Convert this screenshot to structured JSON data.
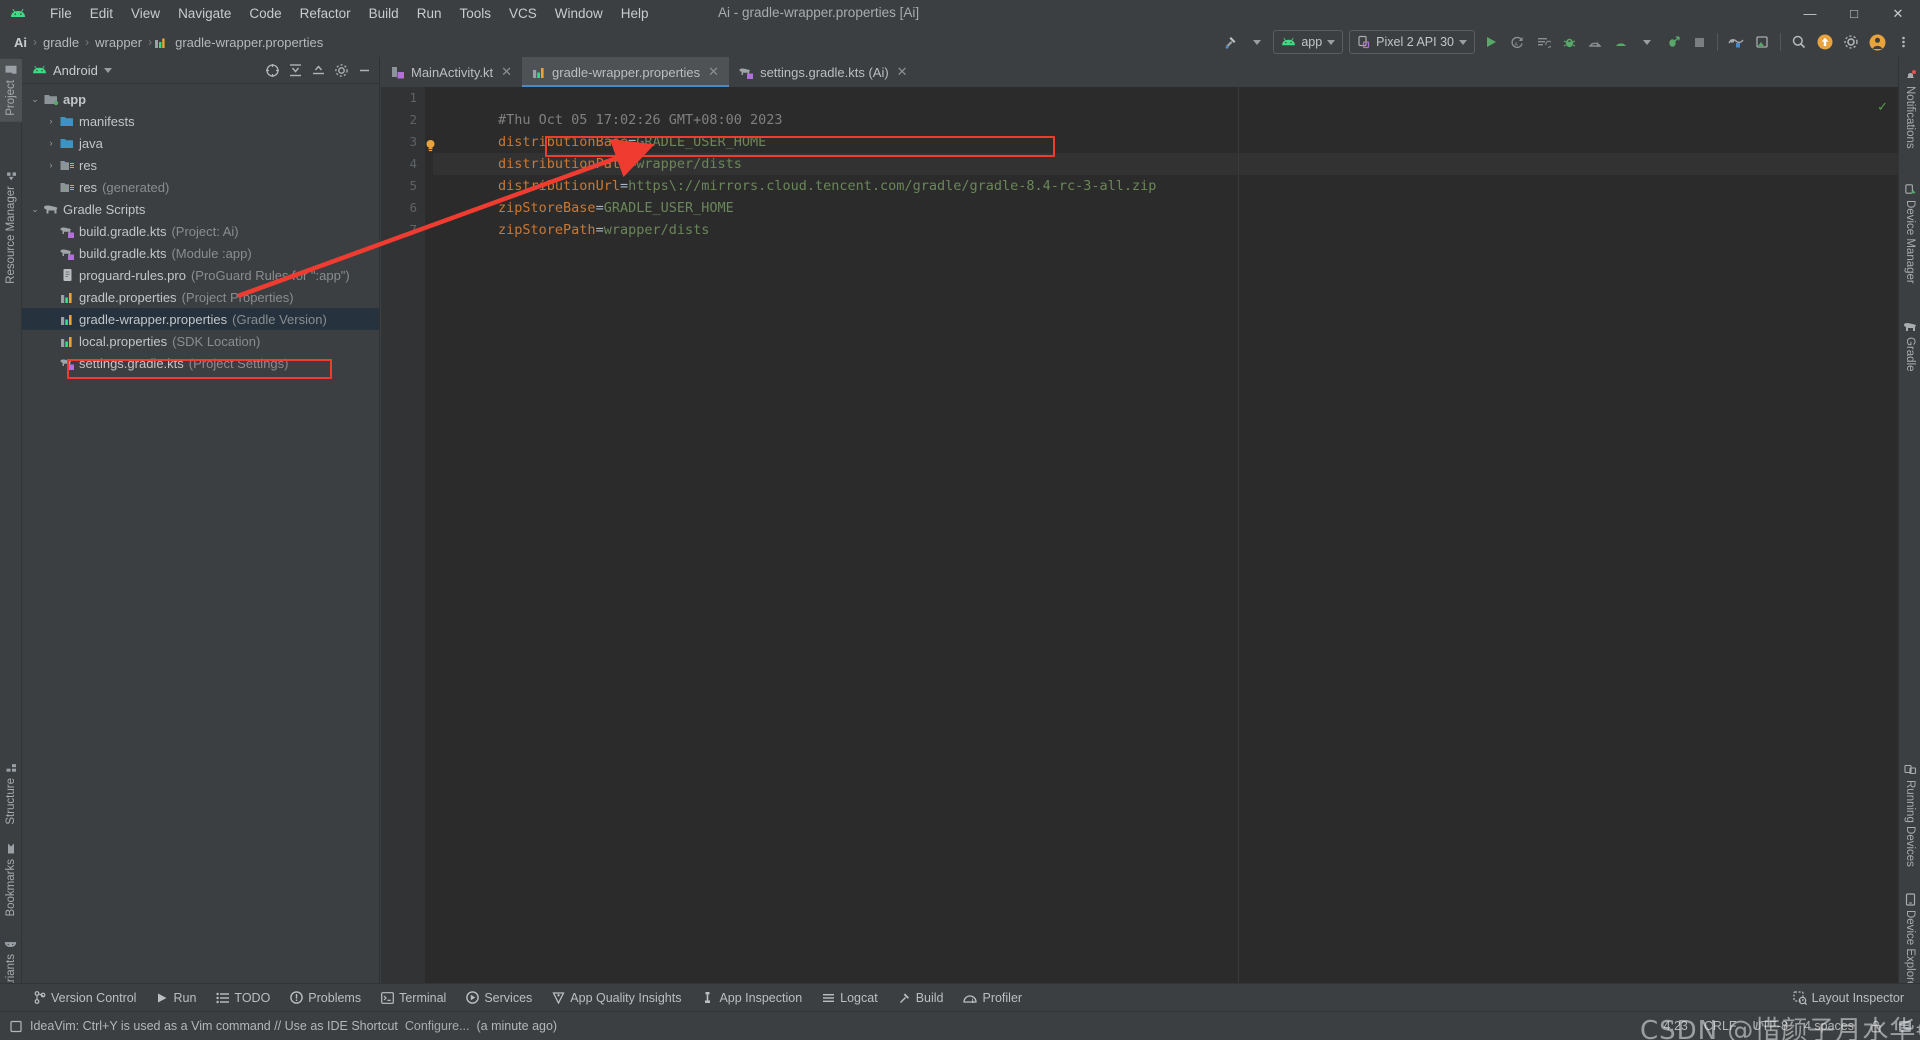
{
  "window": {
    "title": "Ai - gradle-wrapper.properties [Ai]",
    "minimize": "—",
    "maximize": "□",
    "close": "✕"
  },
  "menu": {
    "items": [
      "File",
      "Edit",
      "View",
      "Navigate",
      "Code",
      "Refactor",
      "Build",
      "Run",
      "Tools",
      "VCS",
      "Window",
      "Help"
    ]
  },
  "breadcrumb": {
    "items": [
      "Ai",
      "gradle",
      "wrapper",
      "gradle-wrapper.properties"
    ],
    "separator": "›"
  },
  "toolbar": {
    "build_label": "",
    "app_config": "app",
    "device": "Pixel 2 API 30",
    "icons": [
      "build-hammer-icon",
      "run-icon",
      "rerun-icon",
      "run-with-coverage-icon",
      "debug-icon",
      "profile-icon",
      "attach-debugger-icon",
      "stop-icon",
      "device-mirror-icon",
      "layout-inspector-icon",
      "search-everywhere-icon",
      "update-icon",
      "settings-gear-icon",
      "more-options-icon"
    ]
  },
  "left_strip": {
    "top": [
      {
        "label": "Project",
        "icon": "folder-icon",
        "active": true
      },
      {
        "label": "Resource Manager",
        "icon": "resource-icon",
        "active": false
      }
    ],
    "bottom": [
      {
        "label": "Structure",
        "icon": "structure-icon"
      },
      {
        "label": "Bookmarks",
        "icon": "bookmark-icon"
      },
      {
        "label": "Build Variants",
        "icon": "android-icon"
      }
    ]
  },
  "right_strip": {
    "top": [
      {
        "label": "Notifications",
        "icon": "bell-icon"
      },
      {
        "label": "Device Manager",
        "icon": "device-icon"
      },
      {
        "label": "Gradle",
        "icon": "elephant-icon"
      }
    ],
    "bottom": [
      {
        "label": "Running Devices",
        "icon": "running-devices-icon"
      },
      {
        "label": "Device Explorer",
        "icon": "device-explorer-icon"
      }
    ]
  },
  "project_panel": {
    "title": "Android",
    "actions": [
      "select-opened-file-icon",
      "expand-all-icon",
      "collapse-all-icon",
      "settings-gear-icon",
      "hide-icon"
    ],
    "tree": [
      {
        "indent": 0,
        "arrow": "⌄",
        "icon": "module-folder-icon",
        "label": "app",
        "sub": "",
        "bold": true,
        "selected": false
      },
      {
        "indent": 1,
        "arrow": "›",
        "icon": "folder-icon",
        "label": "manifests",
        "sub": "",
        "bold": false,
        "selected": false
      },
      {
        "indent": 1,
        "arrow": "›",
        "icon": "folder-icon",
        "label": "java",
        "sub": "",
        "bold": false,
        "selected": false
      },
      {
        "indent": 1,
        "arrow": "›",
        "icon": "res-folder-icon",
        "label": "res",
        "sub": "",
        "bold": false,
        "selected": false
      },
      {
        "indent": 1,
        "arrow": "",
        "icon": "res-folder-icon",
        "label": "res",
        "sub": "(generated)",
        "bold": false,
        "selected": false
      },
      {
        "indent": 0,
        "arrow": "⌄",
        "icon": "gradle-elephant-icon",
        "label": "Gradle Scripts",
        "sub": "",
        "bold": false,
        "selected": false
      },
      {
        "indent": 1,
        "arrow": "",
        "icon": "gradle-kts-icon",
        "label": "build.gradle.kts",
        "sub": "(Project: Ai)",
        "bold": false,
        "selected": false
      },
      {
        "indent": 1,
        "arrow": "",
        "icon": "gradle-kts-icon",
        "label": "build.gradle.kts",
        "sub": "(Module :app)",
        "bold": false,
        "selected": false
      },
      {
        "indent": 1,
        "arrow": "",
        "icon": "proguard-icon",
        "label": "proguard-rules.pro",
        "sub": "(ProGuard Rules for \":app\")",
        "bold": false,
        "selected": false
      },
      {
        "indent": 1,
        "arrow": "",
        "icon": "properties-icon",
        "label": "gradle.properties",
        "sub": "(Project Properties)",
        "bold": false,
        "selected": false
      },
      {
        "indent": 1,
        "arrow": "",
        "icon": "properties-icon",
        "label": "gradle-wrapper.properties",
        "sub": "(Gradle Version)",
        "bold": false,
        "selected": true
      },
      {
        "indent": 1,
        "arrow": "",
        "icon": "properties-icon",
        "label": "local.properties",
        "sub": "(SDK Location)",
        "bold": false,
        "selected": false
      },
      {
        "indent": 1,
        "arrow": "",
        "icon": "gradle-kts-icon",
        "label": "settings.gradle.kts",
        "sub": "(Project Settings)",
        "bold": false,
        "selected": false
      }
    ]
  },
  "editor": {
    "tabs": [
      {
        "label": "MainActivity.kt",
        "icon": "kotlin-file-icon",
        "active": false,
        "close": "✕"
      },
      {
        "label": "gradle-wrapper.properties",
        "icon": "properties-icon",
        "active": true,
        "close": "✕"
      },
      {
        "label": "settings.gradle.kts (Ai)",
        "icon": "gradle-kts-icon",
        "active": false,
        "close": "✕"
      }
    ],
    "line_numbers": [
      "1",
      "2",
      "3",
      "4",
      "5",
      "6",
      "7"
    ],
    "lines": [
      {
        "type": "comment",
        "text": "#Thu Oct 05 17:02:26 GMT+08:00 2023"
      },
      {
        "type": "kv",
        "key": "distributionBase",
        "value": "GRADLE_USER_HOME"
      },
      {
        "type": "kv",
        "key": "distributionPath",
        "value": "wrapper/dists"
      },
      {
        "type": "url",
        "key": "distributionUrl",
        "value": "https\\://mirrors.cloud.tencent.com/gradle/gradle-8.4-rc-3-all.zip"
      },
      {
        "type": "kv",
        "key": "zipStoreBase",
        "value": "GRADLE_USER_HOME"
      },
      {
        "type": "kv",
        "key": "zipStorePath",
        "value": "wrapper/dists"
      },
      {
        "type": "blank",
        "text": ""
      }
    ],
    "inspection_status": "✓"
  },
  "bottom_bar": {
    "items": [
      {
        "label": "Version Control",
        "icon": "branch-icon"
      },
      {
        "label": "Run",
        "icon": "run-icon"
      },
      {
        "label": "TODO",
        "icon": "todo-icon"
      },
      {
        "label": "Problems",
        "icon": "problems-icon"
      },
      {
        "label": "Terminal",
        "icon": "terminal-icon"
      },
      {
        "label": "Services",
        "icon": "services-icon"
      },
      {
        "label": "App Quality Insights",
        "icon": "quality-icon"
      },
      {
        "label": "App Inspection",
        "icon": "inspection-icon"
      },
      {
        "label": "Logcat",
        "icon": "logcat-icon"
      },
      {
        "label": "Build",
        "icon": "build-hammer-icon"
      },
      {
        "label": "Profiler",
        "icon": "profiler-icon"
      }
    ],
    "right_item": {
      "label": "Layout Inspector",
      "icon": "layout-inspector-icon"
    }
  },
  "status_bar": {
    "icon": "event-log-icon",
    "message": "IdeaVim: Ctrl+Y is used as a Vim command // Use as IDE Shortcut",
    "configure_link": "Configure...",
    "time_ago": "(a minute ago)",
    "caret_position": "4:23",
    "line_separator": "CRLF",
    "encoding": "UTF-8",
    "indent": "4 spaces",
    "lock_icon": "lock-icon",
    "notification_icon": "notification-icon"
  },
  "annotations": {
    "tree_highlight_color": "#f03b31",
    "url_highlight_color": "#f03b31",
    "arrow_color": "#f03b31"
  },
  "watermark": {
    "text": "CSDN @惜颜子月水华€"
  }
}
